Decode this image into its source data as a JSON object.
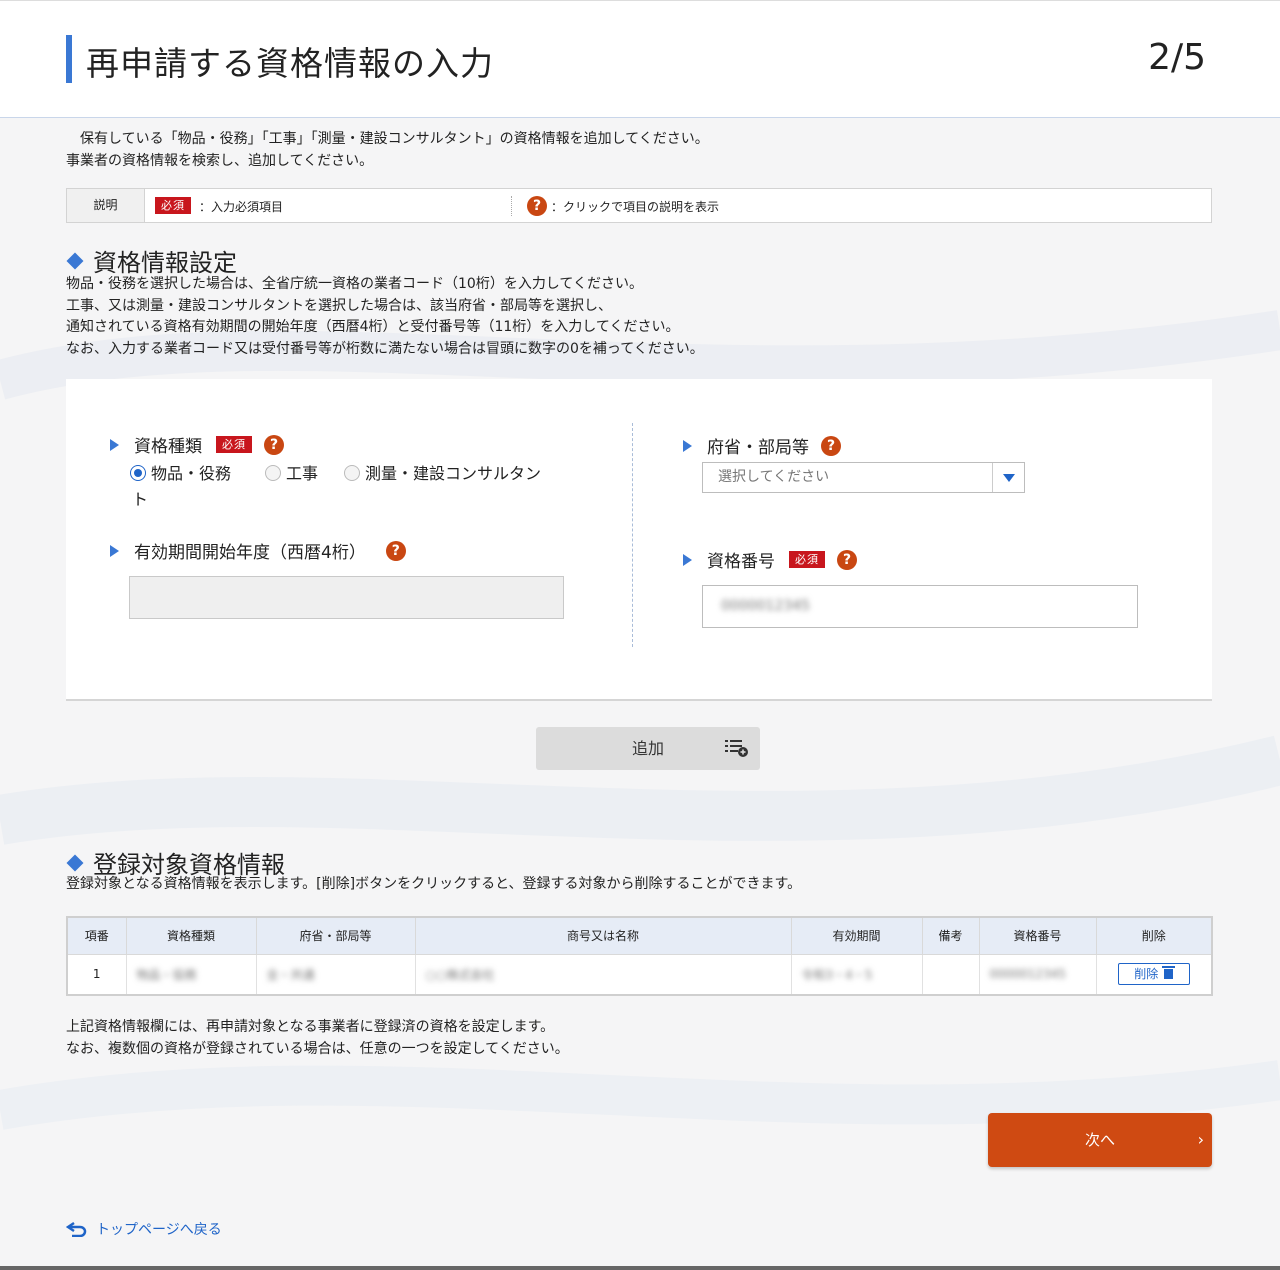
{
  "header": {
    "title": "再申請する資格情報の入力",
    "step": "2/5"
  },
  "intro": {
    "line1": "　保有している「物品・役務」「工事」「測量・建設コンサルタント」の資格情報を追加してください。",
    "line2": "事業者の資格情報を検索し、追加してください。"
  },
  "legend": {
    "label": "説明",
    "required_badge": "必須",
    "required_text": "：入力必須項目",
    "help_icon": "?",
    "help_text": "：クリックで項目の説明を表示"
  },
  "section1": {
    "title": "資格情報設定",
    "desc": [
      "物品・役務を選択した場合は、全省庁統一資格の業者コード（10桁）を入力してください。",
      "工事、又は測量・建設コンサルタントを選択した場合は、該当府省・部局等を選択し、",
      "通知されている資格有効期間の開始年度（西暦4桁）と受付番号等（11桁）を入力してください。",
      "なお、入力する業者コード又は受付番号等が桁数に満たない場合は冒頭に数字の0を補ってください。"
    ]
  },
  "form": {
    "type_label": "資格種類",
    "type_badge": "必須",
    "type_options": [
      "物品・役務",
      "工事",
      "測量・建設コンサルタン",
      "ト"
    ],
    "type_selected": "物品・役務",
    "year_label": "有効期間開始年度（西暦4桁）",
    "ministry_label": "府省・部局等",
    "ministry_placeholder": "選択してください",
    "number_label": "資格番号",
    "number_badge": "必須",
    "number_value": "0000012345"
  },
  "add_button": "追加",
  "section2": {
    "title": "登録対象資格情報",
    "desc": "登録対象となる資格情報を表示します。[削除]ボタンをクリックすると、登録する対象から削除することができます。"
  },
  "table": {
    "headers": [
      "項番",
      "資格種類",
      "府省・部局等",
      "商号又は名称",
      "有効期間",
      "備考",
      "資格番号",
      "削除"
    ],
    "rows": [
      [
        "1",
        "物品・役務",
        "全・共通",
        "○○株式会社",
        "令和3・4・5",
        "",
        "0000012345",
        "削除"
      ]
    ]
  },
  "note": {
    "line1": "上記資格情報欄には、再申請対象となる事業者に登録済の資格を設定します。",
    "line2": "なお、複数個の資格が登録されている場合は、任意の一つを設定してください。"
  },
  "next_button": "次へ",
  "back_link": "トップページへ戻る",
  "colors": {
    "accent": "#3a78d4",
    "required": "#c8161d",
    "help": "#c94712",
    "next": "#cf4a12"
  }
}
